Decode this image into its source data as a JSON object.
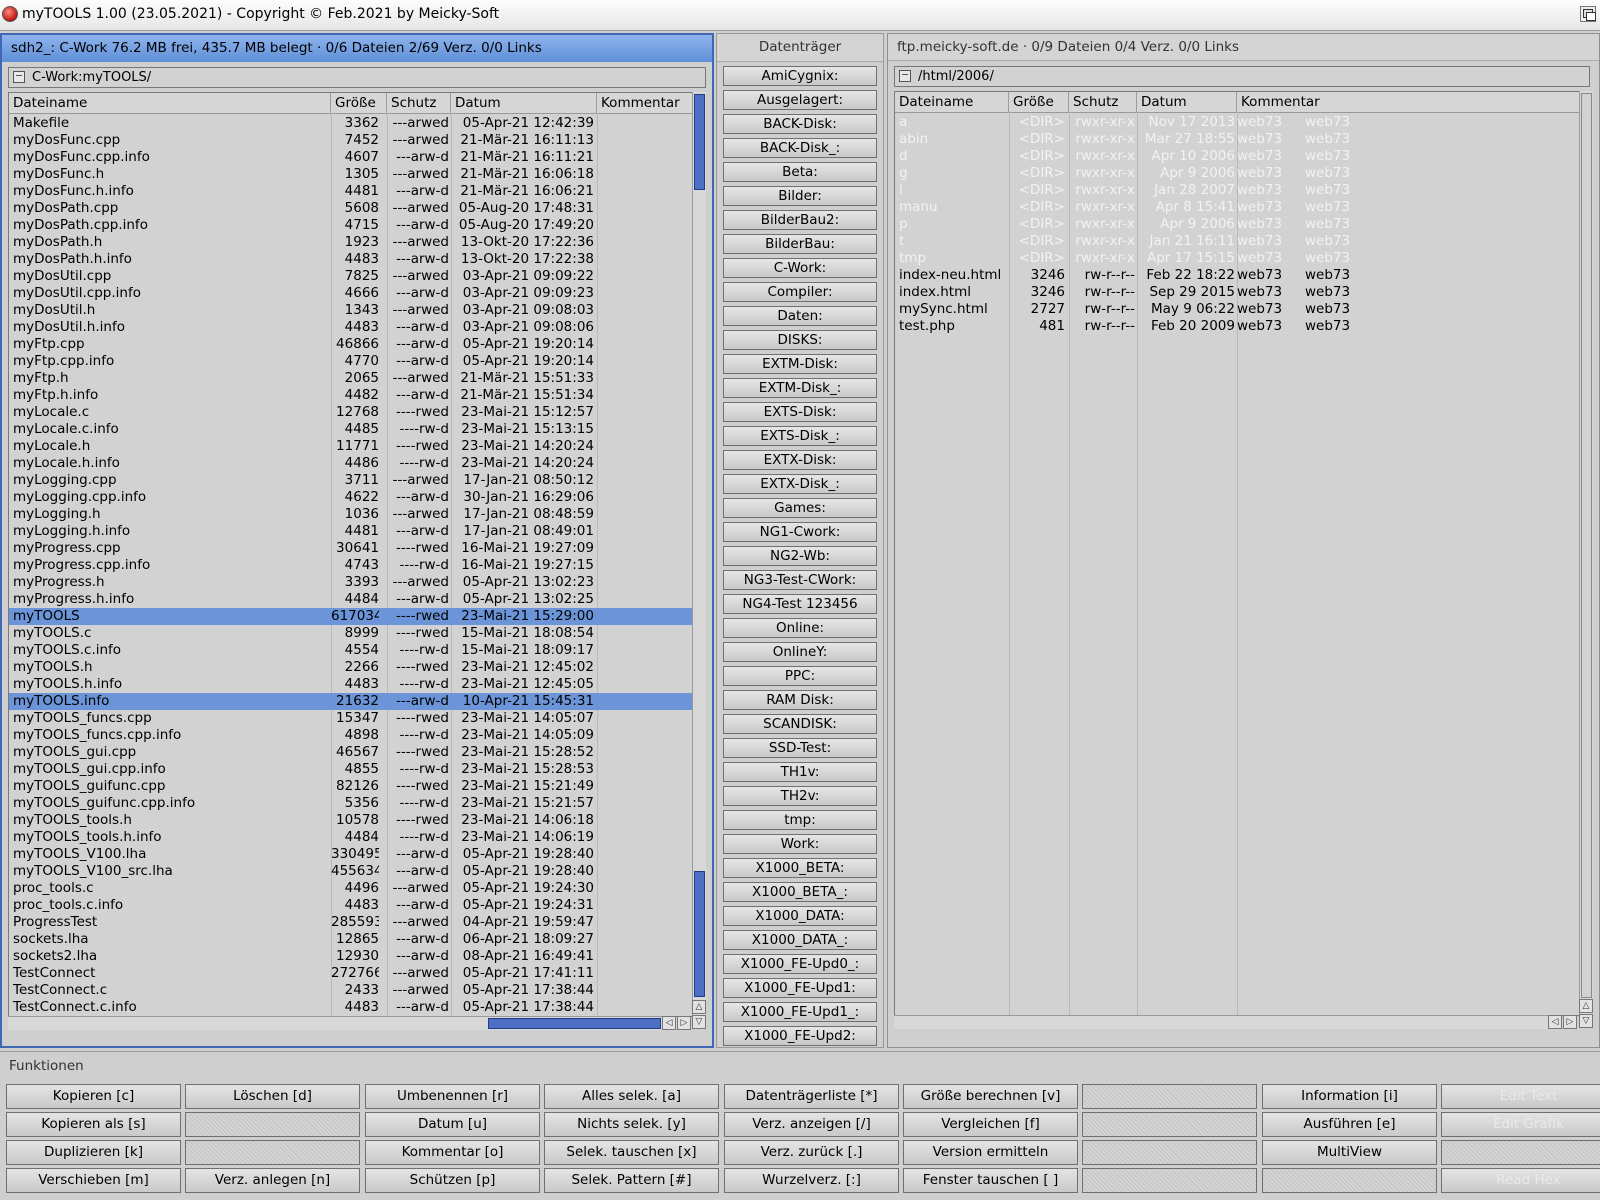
{
  "app": {
    "title": "myTOOLS 1.00 (23.05.2021) - Copyright © Feb.2021 by Meicky-Soft"
  },
  "left_panel": {
    "header": "sdh2_:   C-Work  76.2 MB frei, 435.7 MB belegt · 0/6 Dateien 2/69 Verz. 0/0 Links",
    "path": "C-Work:myTOOLS/",
    "columns": [
      "Dateiname",
      "Größe",
      "Schutz",
      "Datum",
      "Kommentar"
    ],
    "rows": [
      [
        "Makefile",
        "3362",
        "---arwed",
        "05-Apr-21 12:42:39"
      ],
      [
        "myDosFunc.cpp",
        "7452",
        "---arwed",
        "21-Mär-21 16:11:13"
      ],
      [
        "myDosFunc.cpp.info",
        "4607",
        "---arw-d",
        "21-Mär-21 16:11:21"
      ],
      [
        "myDosFunc.h",
        "1305",
        "---arwed",
        "21-Mär-21 16:06:18"
      ],
      [
        "myDosFunc.h.info",
        "4481",
        "---arw-d",
        "21-Mär-21 16:06:21"
      ],
      [
        "myDosPath.cpp",
        "5608",
        "---arwed",
        "05-Aug-20 17:48:31"
      ],
      [
        "myDosPath.cpp.info",
        "4715",
        "---arw-d",
        "05-Aug-20 17:49:20"
      ],
      [
        "myDosPath.h",
        "1923",
        "---arwed",
        "13-Okt-20 17:22:36"
      ],
      [
        "myDosPath.h.info",
        "4483",
        "---arw-d",
        "13-Okt-20 17:22:38"
      ],
      [
        "myDosUtil.cpp",
        "7825",
        "---arwed",
        "03-Apr-21 09:09:22"
      ],
      [
        "myDosUtil.cpp.info",
        "4666",
        "---arw-d",
        "03-Apr-21 09:09:23"
      ],
      [
        "myDosUtil.h",
        "1343",
        "---arwed",
        "03-Apr-21 09:08:03"
      ],
      [
        "myDosUtil.h.info",
        "4483",
        "---arw-d",
        "03-Apr-21 09:08:06"
      ],
      [
        "myFtp.cpp",
        "46866",
        "---arw-d",
        "05-Apr-21 19:20:14"
      ],
      [
        "myFtp.cpp.info",
        "4770",
        "---arw-d",
        "05-Apr-21 19:20:14"
      ],
      [
        "myFtp.h",
        "2065",
        "---arwed",
        "21-Mär-21 15:51:33"
      ],
      [
        "myFtp.h.info",
        "4482",
        "---arw-d",
        "21-Mär-21 15:51:34"
      ],
      [
        "myLocale.c",
        "12768",
        "----rwed",
        "23-Mai-21 15:12:57"
      ],
      [
        "myLocale.c.info",
        "4485",
        "----rw-d",
        "23-Mai-21 15:13:15"
      ],
      [
        "myLocale.h",
        "11771",
        "----rwed",
        "23-Mai-21 14:20:24"
      ],
      [
        "myLocale.h.info",
        "4486",
        "----rw-d",
        "23-Mai-21 14:20:24"
      ],
      [
        "myLogging.cpp",
        "3711",
        "---arwed",
        "17-Jan-21 08:50:12"
      ],
      [
        "myLogging.cpp.info",
        "4622",
        "---arw-d",
        "30-Jan-21 16:29:06"
      ],
      [
        "myLogging.h",
        "1036",
        "---arwed",
        "17-Jan-21 08:48:59"
      ],
      [
        "myLogging.h.info",
        "4481",
        "---arw-d",
        "17-Jan-21 08:49:01"
      ],
      [
        "myProgress.cpp",
        "30641",
        "----rwed",
        "16-Mai-21 19:27:09"
      ],
      [
        "myProgress.cpp.info",
        "4743",
        "----rw-d",
        "16-Mai-21 19:27:15"
      ],
      [
        "myProgress.h",
        "3393",
        "---arwed",
        "05-Apr-21 13:02:23"
      ],
      [
        "myProgress.h.info",
        "4484",
        "---arw-d",
        "05-Apr-21 13:02:25"
      ],
      [
        "myTOOLS",
        "617034",
        "----rwed",
        "23-Mai-21 15:29:00"
      ],
      [
        "myTOOLS.c",
        "8999",
        "----rwed",
        "15-Mai-21 18:08:54"
      ],
      [
        "myTOOLS.c.info",
        "4554",
        "----rw-d",
        "15-Mai-21 18:09:17"
      ],
      [
        "myTOOLS.h",
        "2266",
        "----rwed",
        "23-Mai-21 12:45:02"
      ],
      [
        "myTOOLS.h.info",
        "4483",
        "----rw-d",
        "23-Mai-21 12:45:05"
      ],
      [
        "myTOOLS.info",
        "21632",
        "---arw-d",
        "10-Apr-21 15:45:31"
      ],
      [
        "myTOOLS_funcs.cpp",
        "15347",
        "----rwed",
        "23-Mai-21 14:05:07"
      ],
      [
        "myTOOLS_funcs.cpp.info",
        "4898",
        "----rw-d",
        "23-Mai-21 14:05:09"
      ],
      [
        "myTOOLS_gui.cpp",
        "46567",
        "----rwed",
        "23-Mai-21 15:28:52"
      ],
      [
        "myTOOLS_gui.cpp.info",
        "4855",
        "----rw-d",
        "23-Mai-21 15:28:53"
      ],
      [
        "myTOOLS_guifunc.cpp",
        "82126",
        "----rwed",
        "23-Mai-21 15:21:49"
      ],
      [
        "myTOOLS_guifunc.cpp.info",
        "5356",
        "----rw-d",
        "23-Mai-21 15:21:57"
      ],
      [
        "myTOOLS_tools.h",
        "10578",
        "----rwed",
        "23-Mai-21 14:06:18"
      ],
      [
        "myTOOLS_tools.h.info",
        "4484",
        "----rw-d",
        "23-Mai-21 14:06:19"
      ],
      [
        "myTOOLS_V100.lha",
        "330495",
        "---arw-d",
        "05-Apr-21 19:28:40"
      ],
      [
        "myTOOLS_V100_src.lha",
        "455634",
        "---arw-d",
        "05-Apr-21 19:28:40"
      ],
      [
        "proc_tools.c",
        "4496",
        "---arwed",
        "05-Apr-21 19:24:30"
      ],
      [
        "proc_tools.c.info",
        "4483",
        "---arw-d",
        "05-Apr-21 19:24:31"
      ],
      [
        "ProgressTest",
        "285593",
        "---arwed",
        "04-Apr-21 19:59:47"
      ],
      [
        "sockets.lha",
        "12865",
        "---arw-d",
        "06-Apr-21 18:09:27"
      ],
      [
        "sockets2.lha",
        "12930",
        "---arw-d",
        "08-Apr-21 16:49:41"
      ],
      [
        "TestConnect",
        "272766",
        "---arwed",
        "05-Apr-21 17:41:11"
      ],
      [
        "TestConnect.c",
        "2433",
        "---arwed",
        "05-Apr-21 17:38:44"
      ],
      [
        "TestConnect.c.info",
        "4483",
        "---arw-d",
        "05-Apr-21 17:38:44"
      ]
    ],
    "selected": [
      "myTOOLS",
      "myTOOLS.info"
    ]
  },
  "volumes": {
    "title": "Datenträger",
    "items": [
      "AmiCygnix:",
      "Ausgelagert:",
      "BACK-Disk:",
      "BACK-Disk_:",
      "Beta:",
      "Bilder:",
      "BilderBau2:",
      "BilderBau:",
      "C-Work:",
      "Compiler:",
      "Daten:",
      "DISKS:",
      "EXTM-Disk:",
      "EXTM-Disk_:",
      "EXTS-Disk:",
      "EXTS-Disk_:",
      "EXTX-Disk:",
      "EXTX-Disk_:",
      "Games:",
      "NG1-Cwork:",
      "NG2-Wb:",
      "NG3-Test-CWork:",
      "NG4-Test 123456",
      "Online:",
      "OnlineY:",
      "PPC:",
      "RAM Disk:",
      "SCANDISK:",
      "SSD-Test:",
      "TH1v:",
      "TH2v:",
      "tmp:",
      "Work:",
      "X1000_BETA:",
      "X1000_BETA_:",
      "X1000_DATA:",
      "X1000_DATA_:",
      "X1000_FE-Upd0_:",
      "X1000_FE-Upd1:",
      "X1000_FE-Upd1_:",
      "X1000_FE-Upd2:"
    ]
  },
  "right_panel": {
    "header": "ftp.meicky-soft.de · 0/9 Dateien 0/4 Verz. 0/0 Links",
    "path": "/html/2006/",
    "columns": [
      "Dateiname",
      "Größe",
      "Schutz",
      "Datum",
      "Kommentar"
    ],
    "rows": [
      [
        "a",
        "<DIR>",
        "rwxr-xr-x",
        "Nov 17  2013",
        "web73",
        "web73",
        "dir"
      ],
      [
        "abin",
        "<DIR>",
        "rwxr-xr-x",
        "Mar 27 18:55",
        "web73",
        "web73",
        "dir"
      ],
      [
        "d",
        "<DIR>",
        "rwxr-xr-x",
        "Apr 10  2006",
        "web73",
        "web73",
        "dir"
      ],
      [
        "g",
        "<DIR>",
        "rwxr-xr-x",
        "Apr  9  2006",
        "web73",
        "web73",
        "dir"
      ],
      [
        "i",
        "<DIR>",
        "rwxr-xr-x",
        "Jan 28  2007",
        "web73",
        "web73",
        "dir"
      ],
      [
        "manu",
        "<DIR>",
        "rwxr-xr-x",
        "Apr  8 15:41",
        "web73",
        "web73",
        "dir"
      ],
      [
        "p",
        "<DIR>",
        "rwxr-xr-x",
        "Apr  9  2006",
        "web73",
        "web73",
        "dir"
      ],
      [
        "t",
        "<DIR>",
        "rwxr-xr-x",
        "Jan 21 16:11",
        "web73",
        "web73",
        "dir"
      ],
      [
        "tmp",
        "<DIR>",
        "rwxr-xr-x",
        "Apr 17 15:15",
        "web73",
        "web73",
        "dir"
      ],
      [
        "index-neu.html",
        "3246",
        "rw-r--r--",
        "Feb 22 18:22",
        "web73",
        "web73",
        "file"
      ],
      [
        "index.html",
        "3246",
        "rw-r--r--",
        "Sep 29  2015",
        "web73",
        "web73",
        "file"
      ],
      [
        "mySync.html",
        "2727",
        "rw-r--r--",
        "May  9 06:22",
        "web73",
        "web73",
        "file"
      ],
      [
        "test.php",
        "481",
        "rw-r--r--",
        "Feb 20  2009",
        "web73",
        "web73",
        "file"
      ]
    ]
  },
  "functions": {
    "title": "Funktionen",
    "buttons": [
      [
        "Kopieren [c]",
        "Löschen [d]",
        "Umbenennen [r]",
        "Alles selek. [a]",
        "Datenträgerliste [*]",
        "Größe berechnen [v]",
        "",
        "Information [i]",
        "Edit Text"
      ],
      [
        "Kopieren als [s]",
        "",
        "Datum [u]",
        "Nichts selek. [y]",
        "Verz. anzeigen [/]",
        "Vergleichen [f]",
        "",
        "Ausführen [e]",
        "Edit Grafik"
      ],
      [
        "Duplizieren [k]",
        "",
        "Kommentar [o]",
        "Selek. tauschen [x]",
        "Verz. zurück [.]",
        "Version ermitteln",
        "",
        "MultiView",
        ""
      ],
      [
        "Verschieben [m]",
        "Verz. anlegen [n]",
        "Schützen [p]",
        "Selek. Pattern [#]",
        "Wurzelverz. [:]",
        "Fenster tauschen [ ]",
        "",
        "",
        "Read Hex"
      ]
    ],
    "disabled": [
      "Edit Text",
      "Edit Grafik",
      "Read Hex"
    ]
  },
  "colors": {
    "selection": "#6b95d8",
    "active_header": "#6f9be0",
    "scroll_knob": "#4d6fc4"
  }
}
